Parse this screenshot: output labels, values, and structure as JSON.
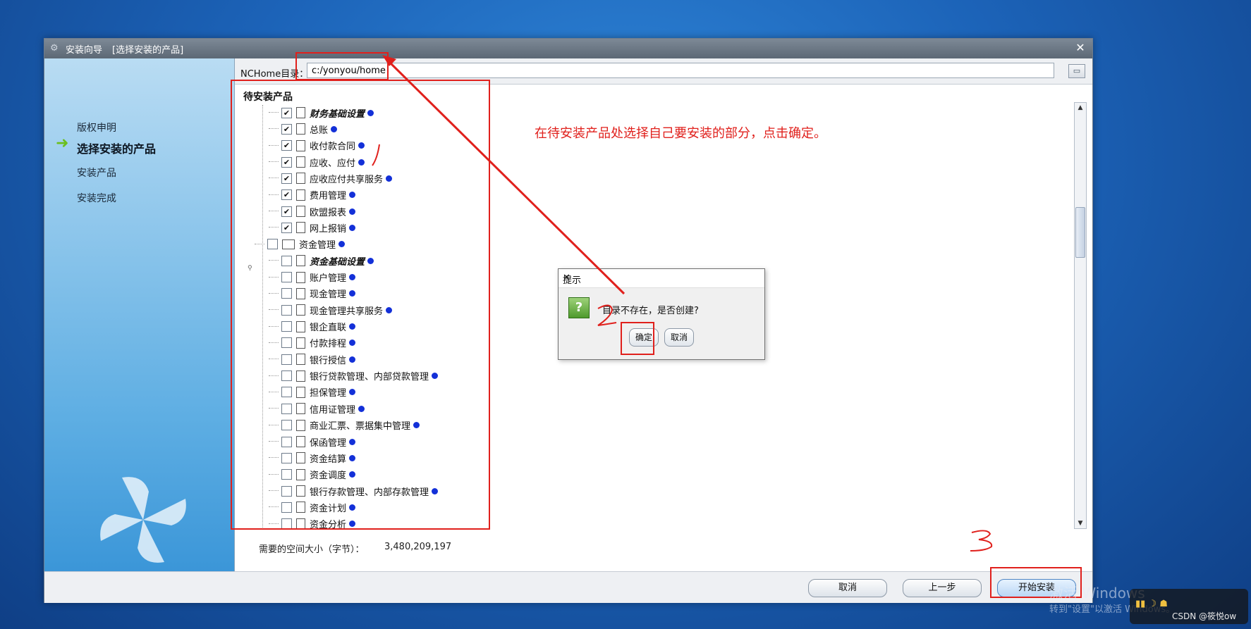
{
  "window": {
    "title": "安装向导",
    "subtitle": "[选择安装的产品]",
    "close_label": "✕"
  },
  "steps": [
    {
      "label": "版权申明",
      "active": false
    },
    {
      "label": "选择安装的产品",
      "active": true
    },
    {
      "label": "安装产品",
      "active": false
    },
    {
      "label": "安装完成",
      "active": false
    }
  ],
  "directory": {
    "label": "NCHome目录：",
    "value": "c:/yonyou/home"
  },
  "tree": {
    "title": "待安装产品",
    "items": [
      {
        "label": "财务基础设置",
        "checked": true,
        "style": "bold-italic"
      },
      {
        "label": "总账",
        "checked": true
      },
      {
        "label": "收付款合同",
        "checked": true
      },
      {
        "label": "应收、应付",
        "checked": true
      },
      {
        "label": "应收应付共享服务",
        "checked": true
      },
      {
        "label": "费用管理",
        "checked": true
      },
      {
        "label": "欧盟报表",
        "checked": true
      },
      {
        "label": "网上报销",
        "checked": true
      },
      {
        "label": "资金管理",
        "checked": false,
        "folder": true
      },
      {
        "label": "资金基础设置",
        "checked": false,
        "style": "bold-italic"
      },
      {
        "label": "账户管理",
        "checked": false
      },
      {
        "label": "现金管理",
        "checked": false
      },
      {
        "label": "现金管理共享服务",
        "checked": false
      },
      {
        "label": "银企直联",
        "checked": false
      },
      {
        "label": "付款排程",
        "checked": false
      },
      {
        "label": "银行授信",
        "checked": false
      },
      {
        "label": "银行贷款管理、内部贷款管理",
        "checked": false
      },
      {
        "label": "担保管理",
        "checked": false
      },
      {
        "label": "信用证管理",
        "checked": false
      },
      {
        "label": "商业汇票、票据集中管理",
        "checked": false
      },
      {
        "label": "保函管理",
        "checked": false
      },
      {
        "label": "资金结算",
        "checked": false
      },
      {
        "label": "资金调度",
        "checked": false
      },
      {
        "label": "银行存款管理、内部存款管理",
        "checked": false
      },
      {
        "label": "资金计划",
        "checked": false
      },
      {
        "label": "资金分析",
        "checked": false
      }
    ]
  },
  "space": {
    "label": "需要的空间大小（字节）：",
    "value": "3,480,209,197"
  },
  "buttons": {
    "cancel": "取消",
    "prev": "上一步",
    "start": "开始安装"
  },
  "dialog": {
    "title": "提示",
    "message": "目录不存在，是否创建?",
    "ok": "确定",
    "cancel": "取消"
  },
  "annotation": {
    "text": "在待安装产品处选择自己要安装的部分，点击确定。",
    "color": "#e0201c"
  },
  "watermark": {
    "line1": "激活 Windows",
    "line2": "转到\"设置\"以激活 Windows。"
  },
  "csdn_badge": "CSDN @筱悦ow"
}
